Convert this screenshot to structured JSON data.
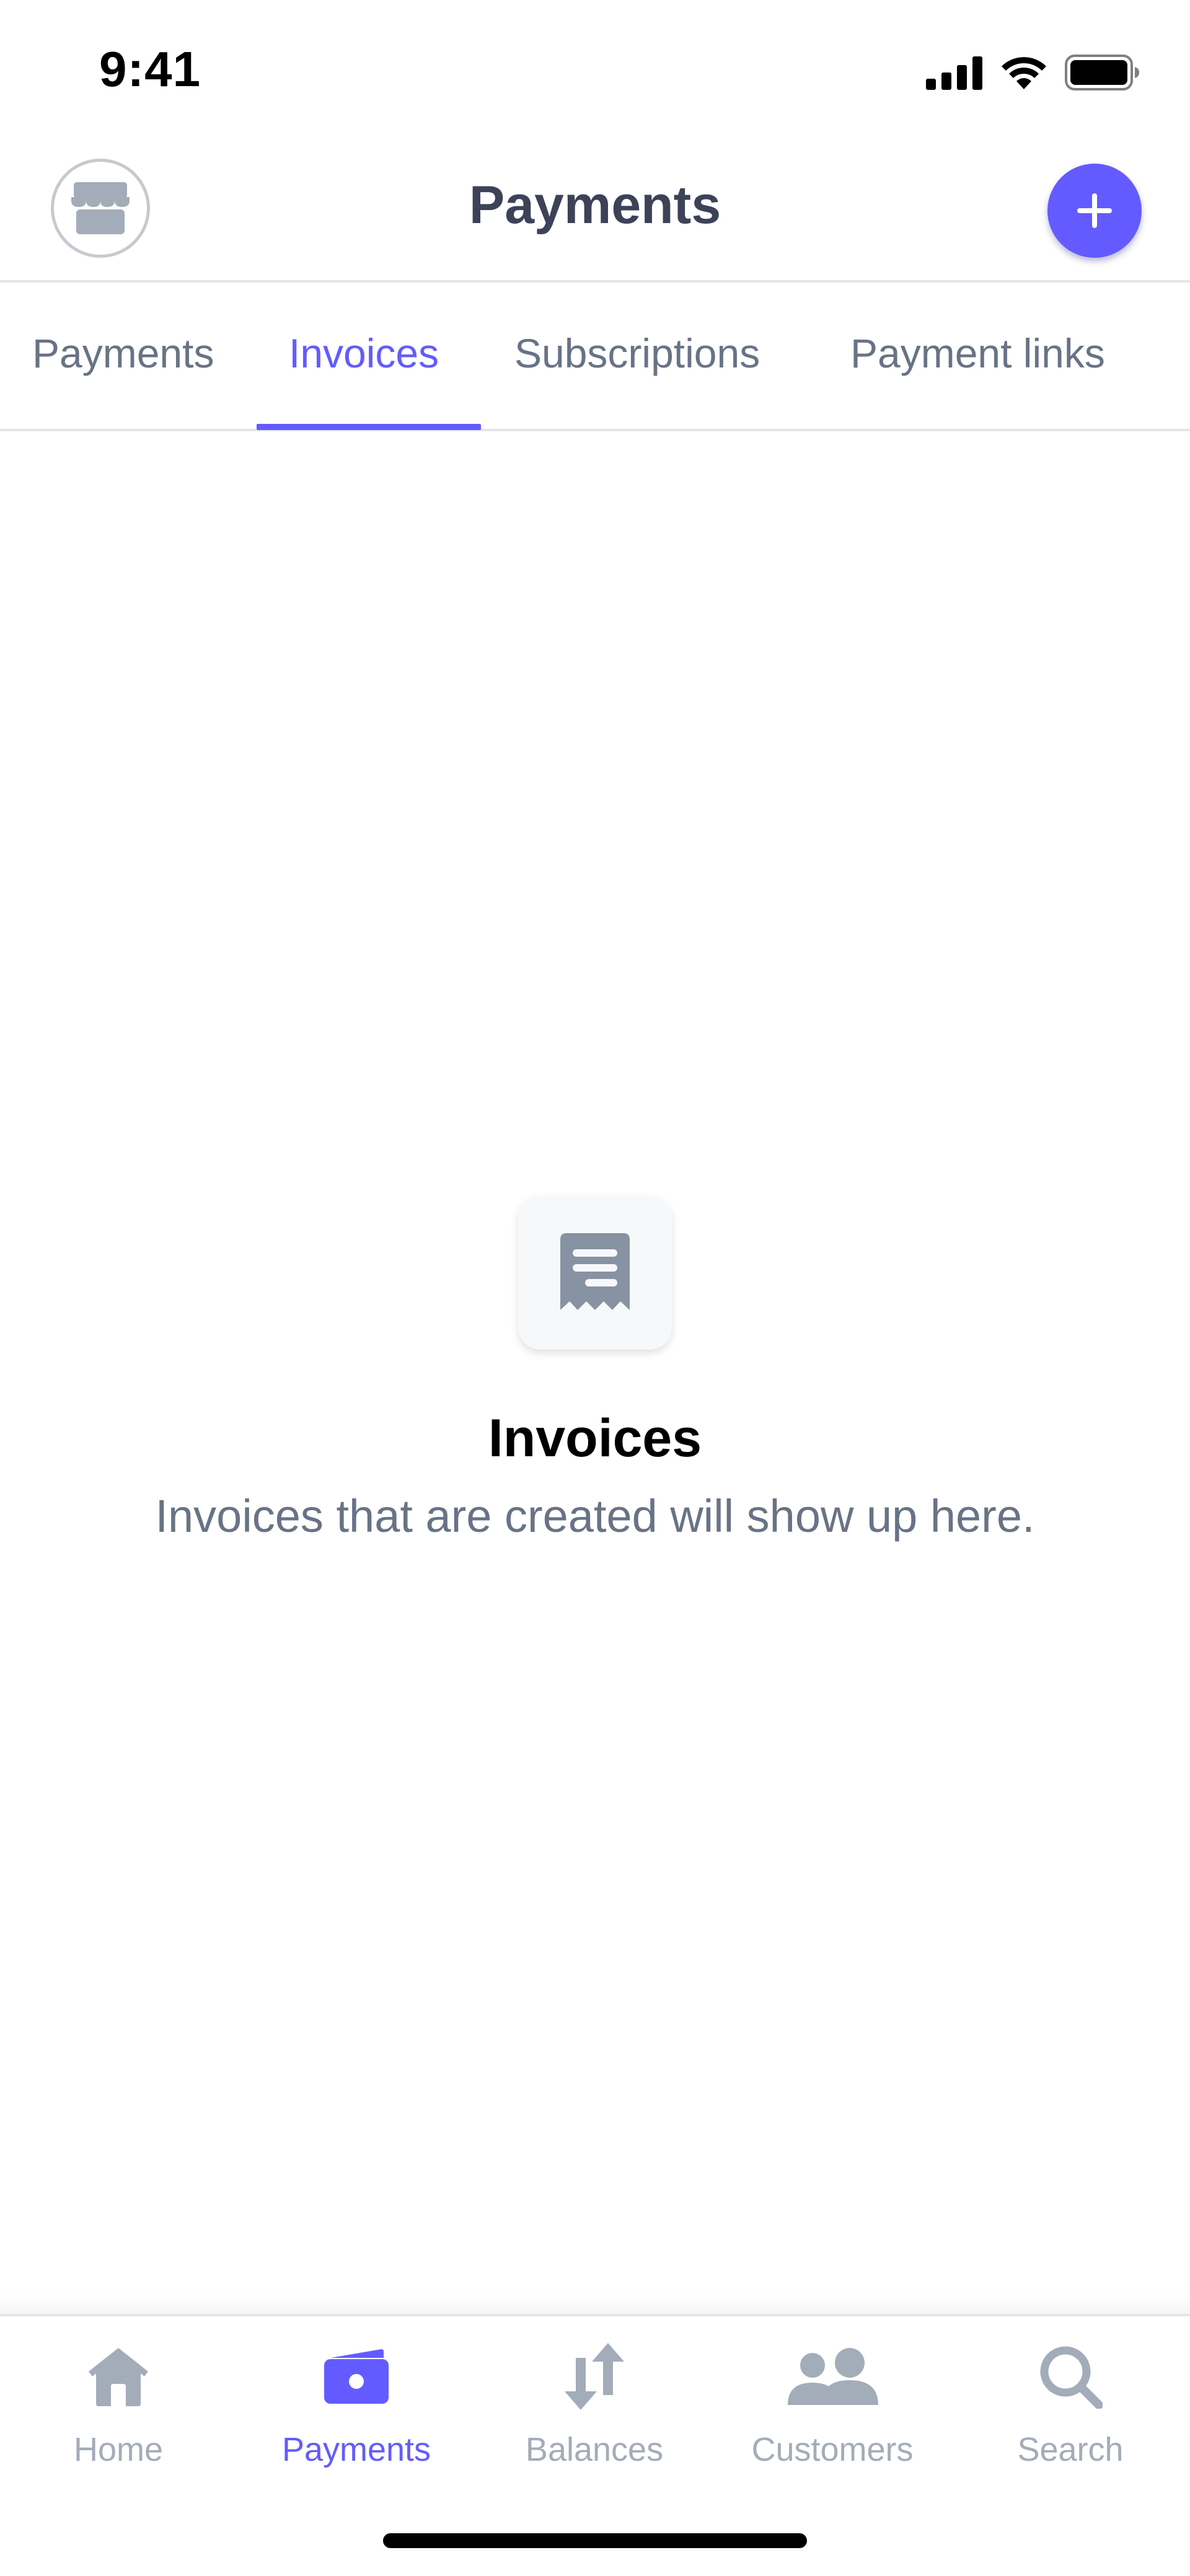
{
  "status_bar": {
    "time": "9:41"
  },
  "header": {
    "title": "Payments",
    "store_icon": "store-icon",
    "add_icon": "plus-icon"
  },
  "tabs": [
    {
      "label": "Payments",
      "active": false
    },
    {
      "label": "Invoices",
      "active": true
    },
    {
      "label": "Subscriptions",
      "active": false
    },
    {
      "label": "Payment links",
      "active": false
    }
  ],
  "empty_state": {
    "icon": "receipt-icon",
    "title": "Invoices",
    "description": "Invoices that are created will show up here."
  },
  "bottom_nav": [
    {
      "label": "Home",
      "icon": "home-icon",
      "active": false
    },
    {
      "label": "Payments",
      "icon": "wallet-icon",
      "active": true
    },
    {
      "label": "Balances",
      "icon": "transfer-arrows-icon",
      "active": false
    },
    {
      "label": "Customers",
      "icon": "customers-icon",
      "active": false
    },
    {
      "label": "Search",
      "icon": "search-icon",
      "active": false
    }
  ],
  "colors": {
    "accent": "#635bff",
    "text_primary": "#3c4257",
    "text_secondary": "#687385",
    "nav_inactive": "#a3acb9",
    "divider": "#e3e5e8"
  }
}
